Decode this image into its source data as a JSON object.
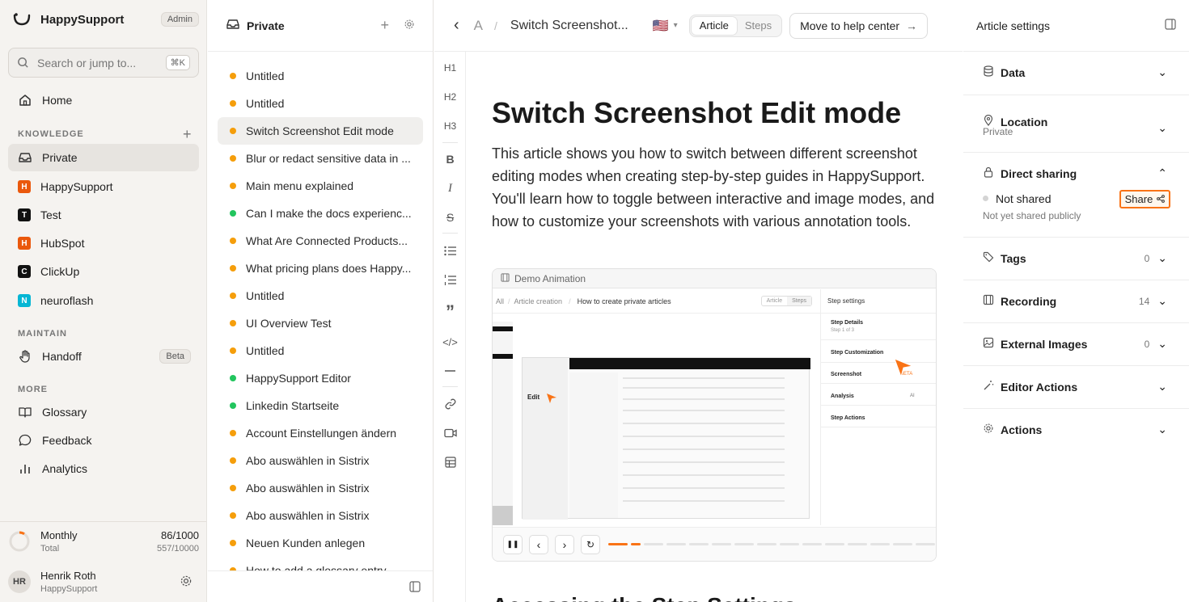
{
  "sidebar": {
    "brand": "HappySupport",
    "role_badge": "Admin",
    "search_placeholder": "Search or jump to...",
    "search_shortcut": "⌘K",
    "home": "Home",
    "knowledge_label": "KNOWLEDGE",
    "spaces": [
      {
        "label": "Private",
        "icon": "inbox-icon"
      },
      {
        "label": "HappySupport",
        "letter": "H",
        "color": "#ea580c"
      },
      {
        "label": "Test",
        "letter": "T",
        "color": "#111111"
      },
      {
        "label": "HubSpot",
        "letter": "H",
        "color": "#ea580c"
      },
      {
        "label": "ClickUp",
        "letter": "C",
        "color": "#111111"
      },
      {
        "label": "neuroflash",
        "letter": "N",
        "color": "#06b6d4"
      }
    ],
    "maintain_label": "MAINTAIN",
    "handoff": "Handoff",
    "handoff_badge": "Beta",
    "more_label": "MORE",
    "more_items": [
      "Glossary",
      "Feedback",
      "Analytics"
    ],
    "usage": {
      "plan": "Monthly",
      "used": "86/1000",
      "total_label": "Total",
      "total": "557/10000"
    },
    "user": {
      "initials": "HR",
      "name": "Henrik Roth",
      "org": "HappySupport"
    }
  },
  "list": {
    "title": "Private",
    "items": [
      {
        "label": "Untitled",
        "status": "orange"
      },
      {
        "label": "Untitled",
        "status": "orange"
      },
      {
        "label": "Switch Screenshot Edit mode",
        "status": "orange"
      },
      {
        "label": "Blur or redact sensitive data in ...",
        "status": "orange"
      },
      {
        "label": "Main menu explained",
        "status": "orange"
      },
      {
        "label": "Can I make the docs experienc...",
        "status": "green"
      },
      {
        "label": "What Are Connected Products...",
        "status": "orange"
      },
      {
        "label": "What pricing plans does Happy...",
        "status": "orange"
      },
      {
        "label": "Untitled",
        "status": "orange"
      },
      {
        "label": "UI Overview Test",
        "status": "orange"
      },
      {
        "label": "Untitled",
        "status": "orange"
      },
      {
        "label": "HappySupport Editor",
        "status": "green"
      },
      {
        "label": "Linkedin Startseite",
        "status": "green"
      },
      {
        "label": "Account Einstellungen ändern",
        "status": "orange"
      },
      {
        "label": "Abo auswählen in Sistrix",
        "status": "orange"
      },
      {
        "label": "Abo auswählen in Sistrix",
        "status": "orange"
      },
      {
        "label": "Abo auswählen in Sistrix",
        "status": "orange"
      },
      {
        "label": "Neuen Kunden anlegen",
        "status": "orange"
      },
      {
        "label": "How to add a glossary entry",
        "status": "orange"
      }
    ]
  },
  "topbar": {
    "crumb_a": "A",
    "crumb_sep": "/",
    "crumb_title": "Switch Screenshot...",
    "flag": "🇺🇸",
    "tab_article": "Article",
    "tab_steps": "Steps",
    "move_button": "Move to help center"
  },
  "tools": {
    "h1": "H1",
    "h2": "H2",
    "h3": "H3"
  },
  "article": {
    "title": "Switch Screenshot Edit mode",
    "intro": "This article shows you how to switch between different screenshot editing modes when creating step-by-step guides in HappySupport. You'll learn how to toggle between interactive and image modes, and how to customize your screenshots with various annotation tools.",
    "demo_label": "Demo Animation",
    "demo": {
      "crumbs": [
        "All",
        "Article creation",
        "How to create private articles"
      ],
      "tab_article": "Article",
      "tab_steps": "Steps",
      "settings_title": "Step settings",
      "settings": [
        "Step Details",
        "Step Customization",
        "Screenshot",
        "Analysis",
        "Step Actions"
      ],
      "step_sub": "Step 1 of 3",
      "beta": "BETA",
      "ai": "AI",
      "edit": "Edit"
    },
    "next_heading": "Accessing the Step Settings"
  },
  "right": {
    "title": "Article settings",
    "sections": {
      "data": "Data",
      "location": "Location",
      "location_value": "Private",
      "direct": "Direct sharing",
      "not_shared": "Not shared",
      "share_button": "Share",
      "not_public": "Not yet shared publicly",
      "tags": "Tags",
      "tags_count": "0",
      "recording": "Recording",
      "recording_count": "14",
      "external": "External Images",
      "external_count": "0",
      "editor_actions": "Editor Actions",
      "actions": "Actions"
    }
  },
  "colors": {
    "accent": "#f97316",
    "orange_dot": "#f59e0b",
    "green_dot": "#22c55e"
  }
}
